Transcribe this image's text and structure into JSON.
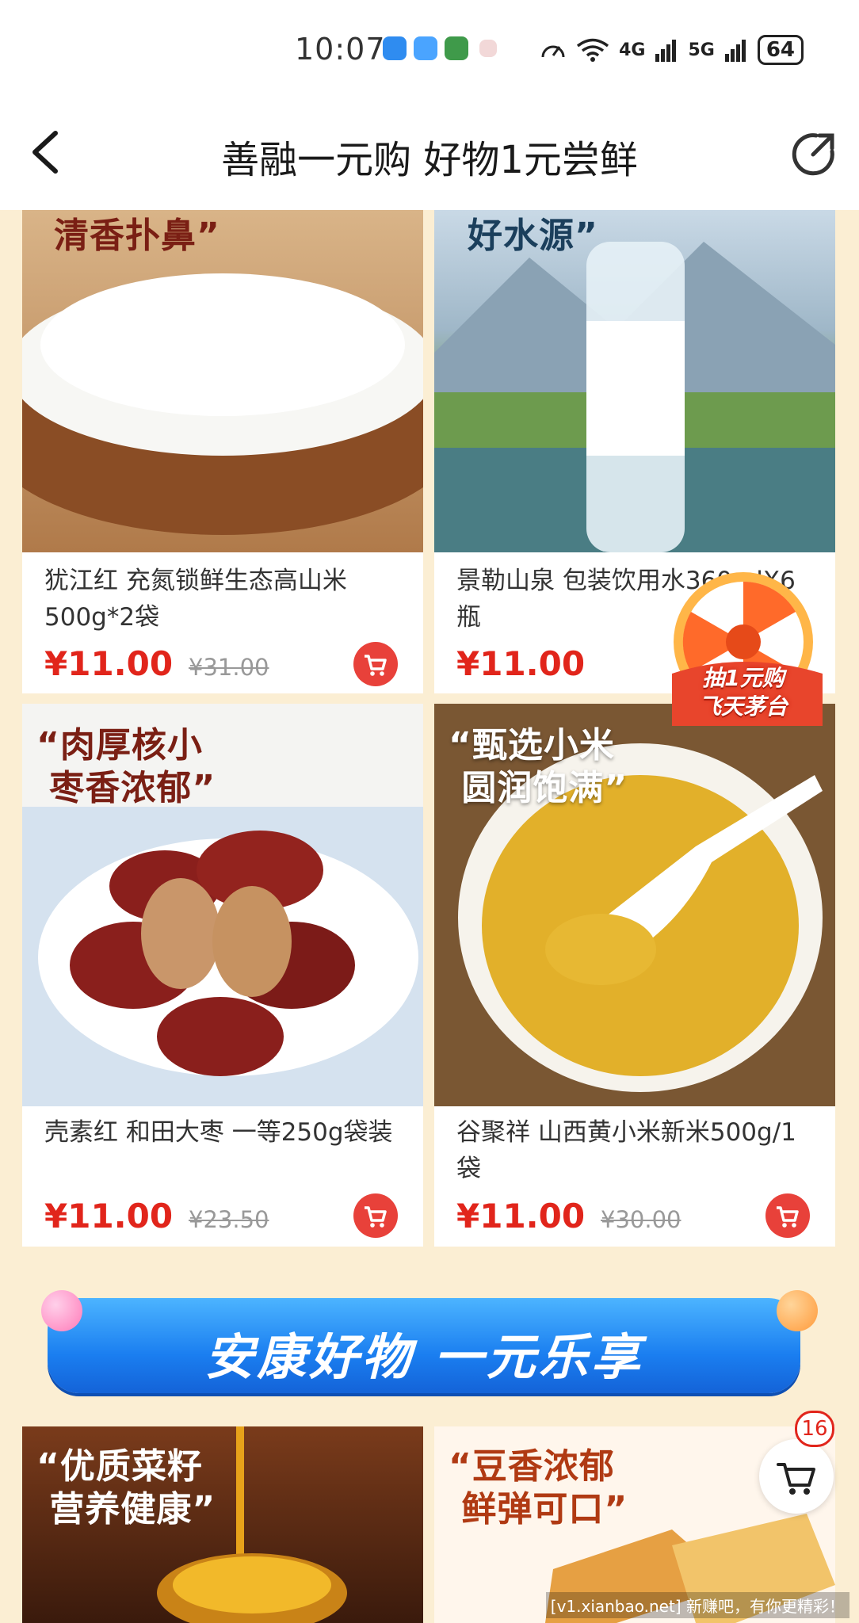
{
  "status_bar": {
    "time": "10:07",
    "network_4g": "4G",
    "network_5g": "5G",
    "battery": "64"
  },
  "header": {
    "title": "善融一元购 好物1元尝鲜",
    "back_icon": "chevron-left-icon",
    "share_icon": "share-icon"
  },
  "products": [
    {
      "slogan": "清香扑鼻”",
      "name": "犹江红 充氮锁鲜生态高山米500g*2袋",
      "price": "¥11.00",
      "original_price": "¥31.00"
    },
    {
      "slogan": "好水源”",
      "name": "景勒山泉 包装饮用水360mlX6瓶",
      "price": "¥11.00",
      "original_price": ""
    },
    {
      "slogan": "“肉厚核小\n 枣香浓郁”",
      "name": "壳素红 和田大枣 一等250g袋装",
      "price": "¥11.00",
      "original_price": "¥23.50"
    },
    {
      "slogan": "“甄选小米\n 圆润饱满”",
      "name": "谷聚祥 山西黄小米新米500g/1袋",
      "price": "¥11.00",
      "original_price": "¥30.00"
    },
    {
      "slogan": "“优质菜籽\n 营养健康”"
    },
    {
      "slogan": "“豆香浓郁\n 鲜弹可口”"
    }
  ],
  "banner": {
    "text": "安康好物 一元乐享"
  },
  "lottery": {
    "text_line1": "抽1元购",
    "text_line2": "飞天茅台"
  },
  "floating_cart": {
    "count": "16"
  },
  "watermark": "[v1.xianbao.net] 新赚吧，有你更精彩！",
  "colors": {
    "price_red": "#e1251b",
    "page_bg": "#fbeed3",
    "banner_blue": "#1a7ef0"
  }
}
